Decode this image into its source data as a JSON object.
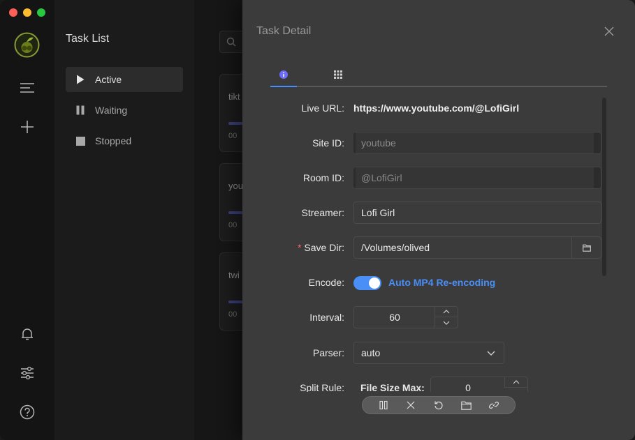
{
  "window": {
    "traffic_lights": {
      "close": "#fe5f57",
      "minimize": "#febc2e",
      "zoom": "#28c840"
    }
  },
  "rail": {
    "icons": [
      "app-logo-icon",
      "menu-icon",
      "plus-icon",
      "bell-icon",
      "sliders-icon",
      "help-icon"
    ]
  },
  "tasklist": {
    "title": "Task List",
    "items": [
      {
        "label": "Active",
        "icon": "play-icon",
        "active": true
      },
      {
        "label": "Waiting",
        "icon": "pause-icon",
        "active": false
      },
      {
        "label": "Stopped",
        "icon": "stop-icon",
        "active": false
      }
    ]
  },
  "cards": [
    {
      "title": "tikt",
      "meta": "00"
    },
    {
      "title": "you",
      "meta": "00"
    },
    {
      "title": "twi",
      "meta": "00"
    }
  ],
  "detail": {
    "title": "Task Detail",
    "tabs": [
      {
        "icon": "info-icon",
        "active": true
      },
      {
        "icon": "grid-icon",
        "active": false
      }
    ],
    "fields": {
      "live_url": {
        "label": "Live URL:",
        "value": "https://www.youtube.com/@LofiGirl"
      },
      "site_id": {
        "label": "Site ID:",
        "value": "youtube"
      },
      "room_id": {
        "label": "Room ID:",
        "value": "@LofiGirl"
      },
      "streamer": {
        "label": "Streamer:",
        "value": "Lofi Girl"
      },
      "save_dir": {
        "label": "Save Dir:",
        "required_mark": "*",
        "value": "/Volumes/olived"
      },
      "encode": {
        "label": "Encode:",
        "enabled": true,
        "text": "Auto MP4 Re-encoding"
      },
      "interval": {
        "label": "Interval:",
        "value": "60"
      },
      "parser": {
        "label": "Parser:",
        "value": "auto"
      },
      "split_rule": {
        "label": "Split Rule:",
        "sublabel": "File Size Max:",
        "value": "0"
      }
    }
  },
  "toolbar": {
    "buttons": [
      "pause-icon",
      "close-icon",
      "restart-icon",
      "folder-icon",
      "link-icon"
    ]
  },
  "colors": {
    "accent": "#4a8ff7",
    "info_tab": "#6b6bff",
    "required": "#f56c6c",
    "drawer_bg": "#3b3b3b"
  }
}
